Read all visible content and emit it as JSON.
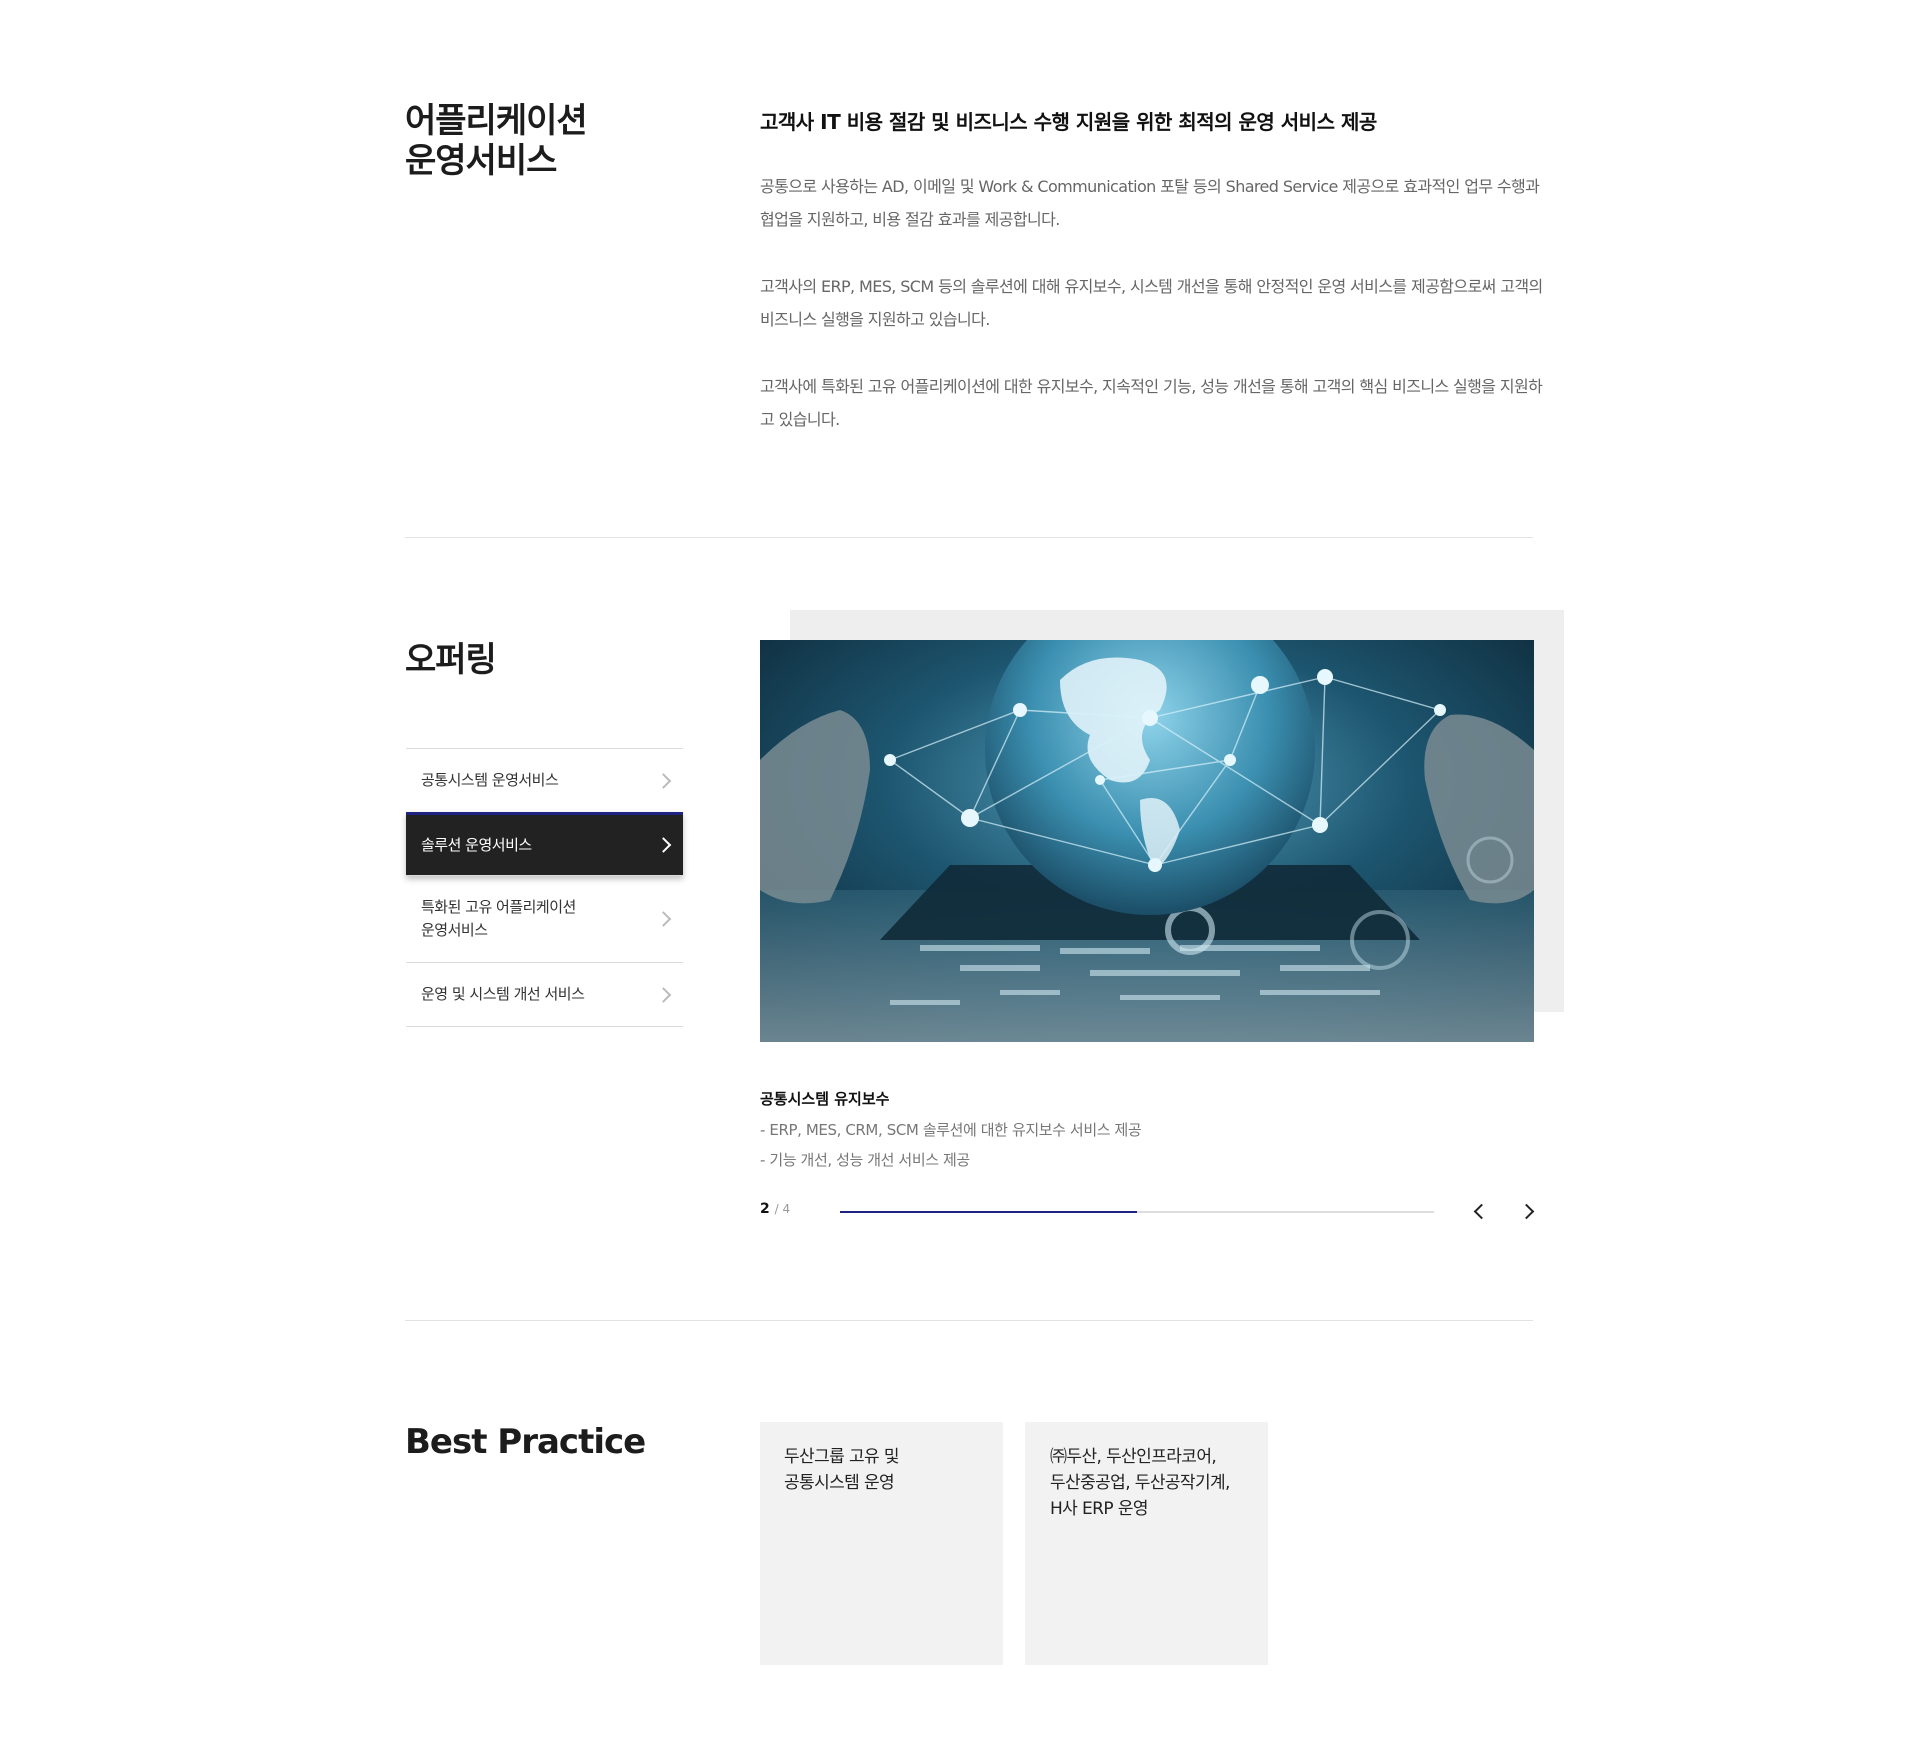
{
  "app_ops": {
    "title_line1": "어플리케이션",
    "title_line2": "운영서비스",
    "lead": "고객사 IT 비용 절감 및 비즈니스 수행 지원을 위한 최적의 운영 서비스 제공",
    "paragraphs": [
      "공통으로 사용하는 AD, 이메일 및 Work & Communication 포탈 등의 Shared Service 제공으로 효과적인 업무 수행과 협업을 지원하고, 비용 절감 효과를 제공합니다.",
      "고객사의 ERP, MES, SCM 등의 솔루션에 대해 유지보수, 시스템 개선을 통해 안정적인 운영 서비스를 제공함으로써 고객의 비즈니스 실행을 지원하고 있습니다.",
      "고객사에 특화된 고유 어플리케이션에 대한 유지보수, 지속적인 기능, 성능 개선을 통해 고객의 핵심 비즈니스 실행을 지원하고 있습니다."
    ]
  },
  "offering": {
    "title": "오퍼링",
    "menu": [
      {
        "label": "공통시스템 운영서비스"
      },
      {
        "label": "솔루션 운영서비스"
      },
      {
        "label": "특화된 고유 어플리케이션\n운영서비스"
      },
      {
        "label": "운영 및 시스템 개선 서비스"
      }
    ],
    "active_index": 1,
    "slide": {
      "caption": "공통시스템 유지보수",
      "lines": [
        "-  ERP, MES, CRM, SCM 솔루션에 대한 유지보수 서비스 제공",
        "-  기능 개선, 성능 개선 서비스 제공"
      ]
    },
    "pager": {
      "current": "2",
      "total": "/ 4",
      "progress_fraction": 0.5
    },
    "accent_color": "#1d237f"
  },
  "best_practice": {
    "title": "Best Practice",
    "cards": [
      {
        "title": "두산그룹 고유 및\n공통시스템 운영"
      },
      {
        "title": "㈜두산, 두산인프라코어,\n두산중공업, 두산공작기계,\nH사 ERP 운영"
      }
    ]
  }
}
